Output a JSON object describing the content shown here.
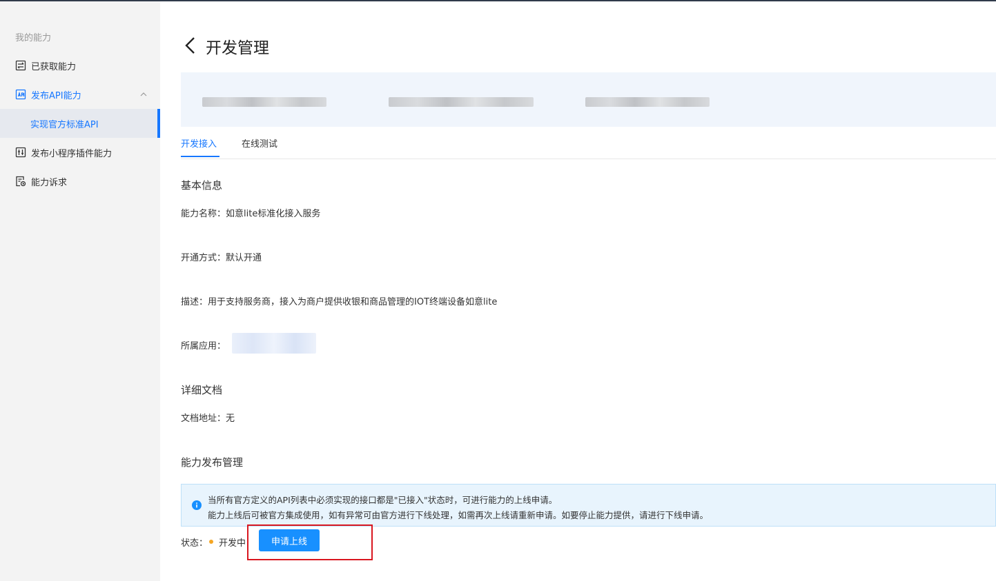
{
  "sidebar": {
    "group_label": "我的能力",
    "items": [
      {
        "label": "已获取能力",
        "icon": "transfer-list-icon"
      },
      {
        "label": "发布API能力",
        "icon": "api-icon"
      },
      {
        "label": "发布小程序插件能力",
        "icon": "plugin-icon"
      },
      {
        "label": "能力诉求",
        "icon": "request-icon"
      }
    ],
    "sub_item": "实现官方标准API"
  },
  "page": {
    "title": "开发管理"
  },
  "tabs": [
    {
      "label": "开发接入",
      "active": true
    },
    {
      "label": "在线测试",
      "active": false
    }
  ],
  "basic_info": {
    "title": "基本信息",
    "ability_name": "能力名称：如意lite标准化接入服务",
    "open_mode": "开通方式：默认开通",
    "description": "描述：用于支持服务商，接入为商户提供收银和商品管理的IOT终端设备如意lite",
    "app_label": "所属应用："
  },
  "docs": {
    "title": "详细文档",
    "address": "文档地址：无"
  },
  "publish": {
    "title": "能力发布管理",
    "notice_line1": "当所有官方定义的API列表中必须实现的接口都是\"已接入\"状态时，可进行能力的上线申请。",
    "notice_line2": "能力上线后可被官方集成使用，如有异常可由官方进行下线处理，如需再次上线请重新申请。如要停止能力提供，请进行下线申请。",
    "status_label": "状态：",
    "status_value": "开发中",
    "status_color": "#f5a623",
    "apply_button": "申请上线"
  },
  "colors": {
    "accent": "#1677ff",
    "highlight": "#d9161f"
  }
}
